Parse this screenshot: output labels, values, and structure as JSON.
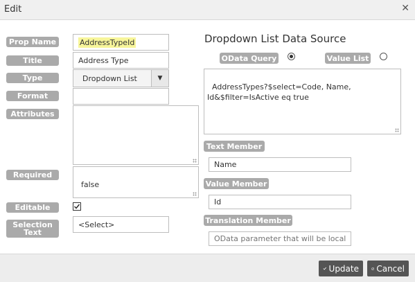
{
  "window": {
    "title": "Edit",
    "close_icon": "close-icon"
  },
  "labels": {
    "prop_name": "Prop Name",
    "title": "Title",
    "type": "Type",
    "format": "Format",
    "attributes": "Attributes",
    "required": "Required",
    "editable": "Editable",
    "selection_text": "Selection Text"
  },
  "fields": {
    "prop_name": "AddressTypeId",
    "title": "Address Type",
    "type": "Dropdown List",
    "format": "",
    "attributes": "",
    "required": "false",
    "editable": true,
    "selection_text": "<Select>"
  },
  "datasource": {
    "heading": "Dropdown List Data Source",
    "odata_label": "OData Query",
    "valuelist_label": "Value List",
    "selected": "odata",
    "query": "AddressTypes?$select=Code, Name,\nId&$filter=IsActive eq true",
    "text_member_label": "Text Member",
    "text_member": "Name",
    "value_member_label": "Value Member",
    "value_member": "Id",
    "translation_member_label": "Translation Member",
    "translation_member_placeholder": "OData parameter that will be localized"
  },
  "footer": {
    "update_label": "Update",
    "cancel_label": "Cancel"
  },
  "colors": {
    "label_bg": "#aaaaaa",
    "button_bg": "#555555",
    "highlight": "#f7f59a"
  }
}
